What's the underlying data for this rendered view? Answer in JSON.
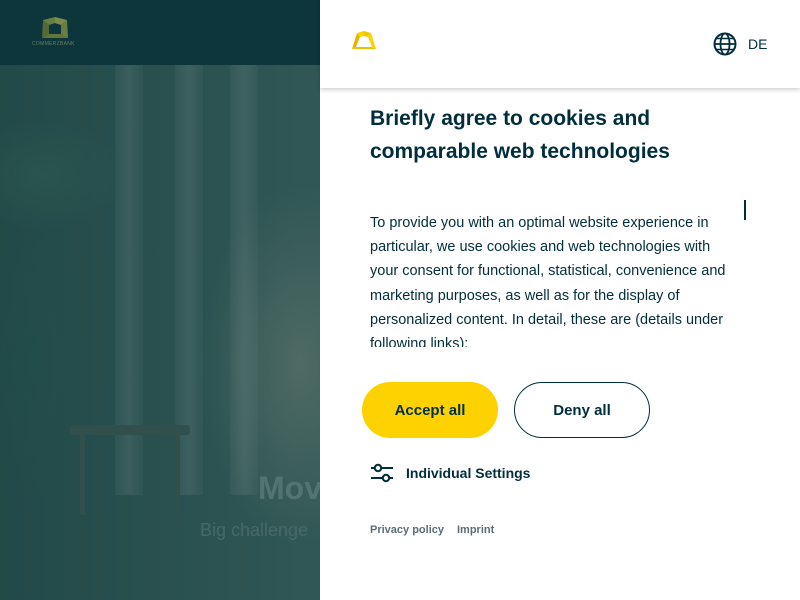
{
  "background": {
    "brand_text": "COMMERZBANK",
    "hero_title": "Mov",
    "hero_subtitle": "Big challenge"
  },
  "panel": {
    "logo_icon": "commerzbank-ribbon-icon",
    "language": {
      "icon": "globe-icon",
      "label": "DE"
    },
    "title": "Briefly agree to cookies and comparable web technologies",
    "body": "To provide you with an optimal website experience in particular, we use cookies and web technologies with your consent for functional, statistical, convenience and marketing purposes, as well as for the display of personalized content. In detail, these are (details under following links):",
    "accept_label": "Accept all",
    "deny_label": "Deny all",
    "settings": {
      "icon": "sliders-icon",
      "label": "Individual Settings"
    },
    "footer_links": [
      "Privacy policy",
      "Imprint"
    ]
  },
  "colors": {
    "brand_yellow": "#fdd200",
    "brand_dark": "#002e3c",
    "header_bg": "#0d3a40"
  }
}
